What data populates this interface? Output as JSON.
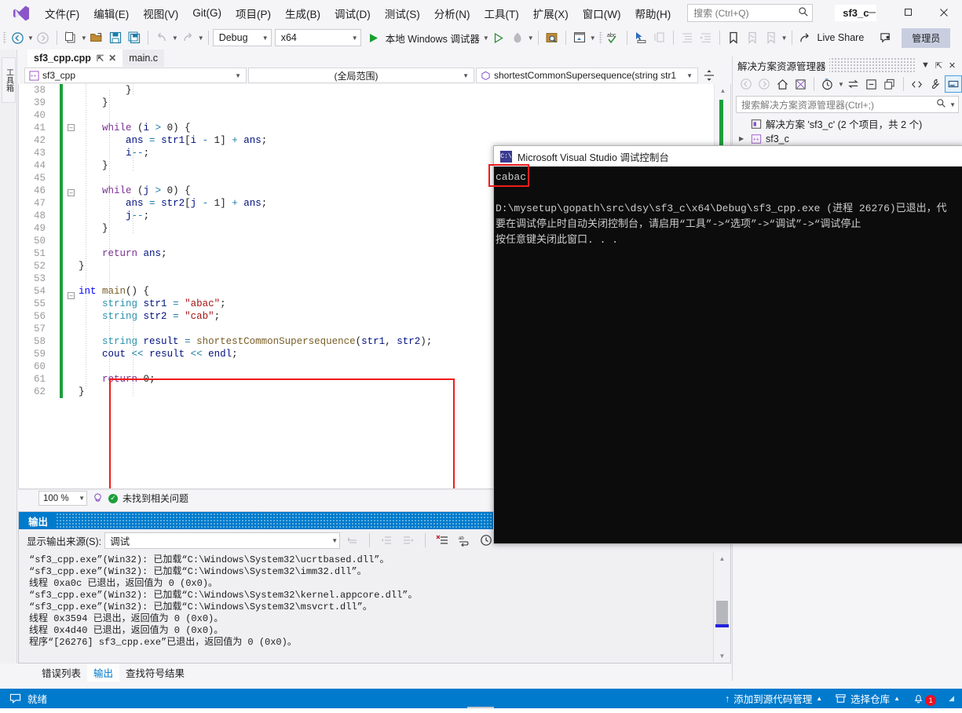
{
  "app": {
    "project_title": "sf3_c",
    "logo_icon": "visual-studio-logo"
  },
  "menu": {
    "items": [
      {
        "label": "文件(F)",
        "name": "file"
      },
      {
        "label": "编辑(E)",
        "name": "edit"
      },
      {
        "label": "视图(V)",
        "name": "view"
      },
      {
        "label": "Git(G)",
        "name": "git"
      },
      {
        "label": "项目(P)",
        "name": "project"
      },
      {
        "label": "生成(B)",
        "name": "build"
      },
      {
        "label": "调试(D)",
        "name": "debug"
      },
      {
        "label": "测试(S)",
        "name": "test"
      },
      {
        "label": "分析(N)",
        "name": "analyze"
      },
      {
        "label": "工具(T)",
        "name": "tools"
      },
      {
        "label": "扩展(X)",
        "name": "extensions"
      },
      {
        "label": "窗口(W)",
        "name": "window"
      },
      {
        "label": "帮助(H)",
        "name": "help"
      }
    ]
  },
  "search": {
    "placeholder": "搜索 (Ctrl+Q)",
    "icon": "search-icon"
  },
  "window_controls": {
    "minimize": "—",
    "maximize": "▢",
    "close": "✕"
  },
  "toolbar": {
    "config": "Debug",
    "platform": "x64",
    "run_label": "本地 Windows 调试器",
    "live_share": "Live Share",
    "admin": "管理员"
  },
  "editor": {
    "tabs": [
      {
        "label": "sf3_cpp.cpp",
        "active": true
      },
      {
        "label": "main.c",
        "active": false
      }
    ],
    "nav": {
      "project": "sf3_cpp",
      "scope": "(全局范围)",
      "member": "shortestCommonSupersequence(string str1"
    },
    "zoom": "100 %",
    "issues": "未找到相关问题",
    "lines": [
      {
        "n": "38",
        "fold": "",
        "text": "        }"
      },
      {
        "n": "39",
        "fold": "",
        "text": "    }"
      },
      {
        "n": "40",
        "fold": "",
        "text": ""
      },
      {
        "n": "41",
        "fold": "-",
        "text": "    while (i > 0) {"
      },
      {
        "n": "42",
        "fold": "",
        "text": "        ans = str1[i - 1] + ans;"
      },
      {
        "n": "43",
        "fold": "",
        "text": "        i--;"
      },
      {
        "n": "44",
        "fold": "",
        "text": "    }"
      },
      {
        "n": "45",
        "fold": "",
        "text": ""
      },
      {
        "n": "46",
        "fold": "-",
        "text": "    while (j > 0) {"
      },
      {
        "n": "47",
        "fold": "",
        "text": "        ans = str2[j - 1] + ans;"
      },
      {
        "n": "48",
        "fold": "",
        "text": "        j--;"
      },
      {
        "n": "49",
        "fold": "",
        "text": "    }"
      },
      {
        "n": "50",
        "fold": "",
        "text": ""
      },
      {
        "n": "51",
        "fold": "",
        "text": "    return ans;"
      },
      {
        "n": "52",
        "fold": "",
        "text": "}"
      },
      {
        "n": "53",
        "fold": "",
        "text": ""
      },
      {
        "n": "54",
        "fold": "-",
        "text": "int main() {"
      },
      {
        "n": "55",
        "fold": "",
        "text": "    string str1 = \"abac\";"
      },
      {
        "n": "56",
        "fold": "",
        "text": "    string str2 = \"cab\";"
      },
      {
        "n": "57",
        "fold": "",
        "text": ""
      },
      {
        "n": "58",
        "fold": "",
        "text": "    string result = shortestCommonSupersequence(str1, str2);"
      },
      {
        "n": "59",
        "fold": "",
        "text": "    cout << result << endl;"
      },
      {
        "n": "60",
        "fold": "",
        "text": ""
      },
      {
        "n": "61",
        "fold": "",
        "text": "    return 0;"
      },
      {
        "n": "62",
        "fold": "",
        "text": "}"
      }
    ]
  },
  "output": {
    "title": "输出",
    "source_label": "显示输出来源(S):",
    "source_value": "调试",
    "lines": [
      "“sf3_cpp.exe”(Win32): 已加载“C:\\Windows\\System32\\ucrtbased.dll”。",
      "“sf3_cpp.exe”(Win32): 已加载“C:\\Windows\\System32\\imm32.dll”。",
      "线程 0xa0c 已退出，返回值为 0 (0x0)。",
      "“sf3_cpp.exe”(Win32): 已加载“C:\\Windows\\System32\\kernel.appcore.dll”。",
      "“sf3_cpp.exe”(Win32): 已加载“C:\\Windows\\System32\\msvcrt.dll”。",
      "线程 0x3594 已退出，返回值为 0 (0x0)。",
      "线程 0x4d40 已退出，返回值为 0 (0x0)。",
      "程序“[26276] sf3_cpp.exe”已退出，返回值为 0 (0x0)。"
    ]
  },
  "bottom_tabs": [
    {
      "label": "错误列表",
      "active": false
    },
    {
      "label": "输出",
      "active": true
    },
    {
      "label": "查找符号结果",
      "active": false
    }
  ],
  "solution_explorer": {
    "title": "解决方案资源管理器",
    "search_placeholder": "搜索解决方案资源管理器(Ctrl+;)",
    "tree": [
      {
        "label": "解决方案 'sf3_c' (2 个项目，共 2 个)",
        "depth": 0,
        "icon": "solution-icon"
      },
      {
        "label": "sf3_c",
        "depth": 1,
        "icon": "project-icon"
      }
    ]
  },
  "console": {
    "title": "Microsoft Visual Studio 调试控制台",
    "icon_label": "C:\\",
    "lines": [
      "cabac",
      "",
      "D:\\mysetup\\gopath\\src\\dsy\\sf3_c\\x64\\Debug\\sf3_cpp.exe (进程 26276)已退出，代",
      "要在调试停止时自动关闭控制台，请启用“工具”->“选项”->“调试”->“调试停止",
      "按任意键关闭此窗口. . ."
    ]
  },
  "toolbox_rail": {
    "label": "工具箱"
  },
  "statusbar": {
    "ready": "就绪",
    "source_control": "添加到源代码管理",
    "repo": "选择仓库",
    "notification_count": "1"
  },
  "colors": {
    "accent": "#007acc",
    "highlight_box": "#f21b1b",
    "change_bar": "#1d9e3b",
    "console_bg": "#0c0c0c"
  }
}
